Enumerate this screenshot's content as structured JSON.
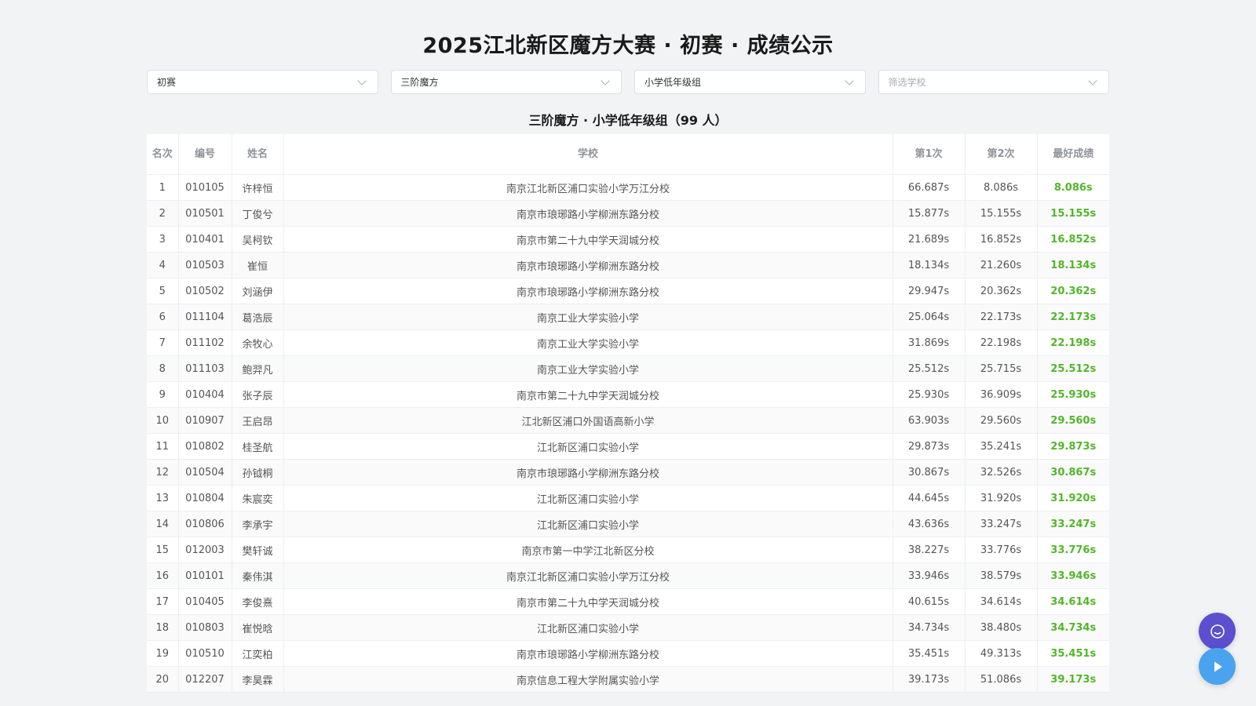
{
  "title": "2025江北新区魔方大赛 · 初赛 · 成绩公示",
  "filters": {
    "round": "初赛",
    "event": "三阶魔方",
    "group": "小学低年级组",
    "school_placeholder": "筛选学校"
  },
  "subtitle": "三阶魔方 · 小学低年级组（99 人）",
  "table": {
    "headers": {
      "rank": "名次",
      "id": "编号",
      "name": "姓名",
      "school": "学校",
      "attempt1": "第1次",
      "attempt2": "第2次",
      "best": "最好成绩"
    },
    "rows": [
      {
        "rank": "1",
        "id": "010105",
        "name": "许梓恒",
        "school": "南京江北新区浦口实验小学万江分校",
        "attempt1": "66.687s",
        "attempt2": "8.086s",
        "best": "8.086s"
      },
      {
        "rank": "2",
        "id": "010501",
        "name": "丁俊兮",
        "school": "南京市琅琊路小学柳洲东路分校",
        "attempt1": "15.877s",
        "attempt2": "15.155s",
        "best": "15.155s"
      },
      {
        "rank": "3",
        "id": "010401",
        "name": "吴柯钦",
        "school": "南京市第二十九中学天润城分校",
        "attempt1": "21.689s",
        "attempt2": "16.852s",
        "best": "16.852s"
      },
      {
        "rank": "4",
        "id": "010503",
        "name": "崔恒",
        "school": "南京市琅琊路小学柳洲东路分校",
        "attempt1": "18.134s",
        "attempt2": "21.260s",
        "best": "18.134s"
      },
      {
        "rank": "5",
        "id": "010502",
        "name": "刘涵伊",
        "school": "南京市琅琊路小学柳洲东路分校",
        "attempt1": "29.947s",
        "attempt2": "20.362s",
        "best": "20.362s"
      },
      {
        "rank": "6",
        "id": "011104",
        "name": "葛浩辰",
        "school": "南京工业大学实验小学",
        "attempt1": "25.064s",
        "attempt2": "22.173s",
        "best": "22.173s"
      },
      {
        "rank": "7",
        "id": "011102",
        "name": "余牧心",
        "school": "南京工业大学实验小学",
        "attempt1": "31.869s",
        "attempt2": "22.198s",
        "best": "22.198s"
      },
      {
        "rank": "8",
        "id": "011103",
        "name": "鲍羿凡",
        "school": "南京工业大学实验小学",
        "attempt1": "25.512s",
        "attempt2": "25.715s",
        "best": "25.512s"
      },
      {
        "rank": "9",
        "id": "010404",
        "name": "张子辰",
        "school": "南京市第二十九中学天润城分校",
        "attempt1": "25.930s",
        "attempt2": "36.909s",
        "best": "25.930s"
      },
      {
        "rank": "10",
        "id": "010907",
        "name": "王启昂",
        "school": "江北新区浦口外国语高新小学",
        "attempt1": "63.903s",
        "attempt2": "29.560s",
        "best": "29.560s"
      },
      {
        "rank": "11",
        "id": "010802",
        "name": "桂圣航",
        "school": "江北新区浦口实验小学",
        "attempt1": "29.873s",
        "attempt2": "35.241s",
        "best": "29.873s"
      },
      {
        "rank": "12",
        "id": "010504",
        "name": "孙钺桐",
        "school": "南京市琅琊路小学柳洲东路分校",
        "attempt1": "30.867s",
        "attempt2": "32.526s",
        "best": "30.867s"
      },
      {
        "rank": "13",
        "id": "010804",
        "name": "朱宸奕",
        "school": "江北新区浦口实验小学",
        "attempt1": "44.645s",
        "attempt2": "31.920s",
        "best": "31.920s"
      },
      {
        "rank": "14",
        "id": "010806",
        "name": "李承宇",
        "school": "江北新区浦口实验小学",
        "attempt1": "43.636s",
        "attempt2": "33.247s",
        "best": "33.247s"
      },
      {
        "rank": "15",
        "id": "012003",
        "name": "樊轩诚",
        "school": "南京市第一中学江北新区分校",
        "attempt1": "38.227s",
        "attempt2": "33.776s",
        "best": "33.776s"
      },
      {
        "rank": "16",
        "id": "010101",
        "name": "秦伟淇",
        "school": "南京江北新区浦口实验小学万江分校",
        "attempt1": "33.946s",
        "attempt2": "38.579s",
        "best": "33.946s"
      },
      {
        "rank": "17",
        "id": "010405",
        "name": "李俊熹",
        "school": "南京市第二十九中学天润城分校",
        "attempt1": "40.615s",
        "attempt2": "34.614s",
        "best": "34.614s"
      },
      {
        "rank": "18",
        "id": "010803",
        "name": "崔悦晗",
        "school": "江北新区浦口实验小学",
        "attempt1": "34.734s",
        "attempt2": "38.480s",
        "best": "34.734s"
      },
      {
        "rank": "19",
        "id": "010510",
        "name": "江奕柏",
        "school": "南京市琅琊路小学柳洲东路分校",
        "attempt1": "35.451s",
        "attempt2": "49.313s",
        "best": "35.451s"
      },
      {
        "rank": "20",
        "id": "012207",
        "name": "李昊霖",
        "school": "南京信息工程大学附属实验小学",
        "attempt1": "39.173s",
        "attempt2": "51.086s",
        "best": "39.173s"
      }
    ]
  },
  "floating_buttons": {
    "chat_icon": "chat-bubble-icon",
    "play_icon": "play-icon"
  },
  "colors": {
    "best_time": "#52b62b",
    "chat_button": "#5b4fd0",
    "play_button": "#4aa3ef",
    "background": "#f2f3f5"
  }
}
